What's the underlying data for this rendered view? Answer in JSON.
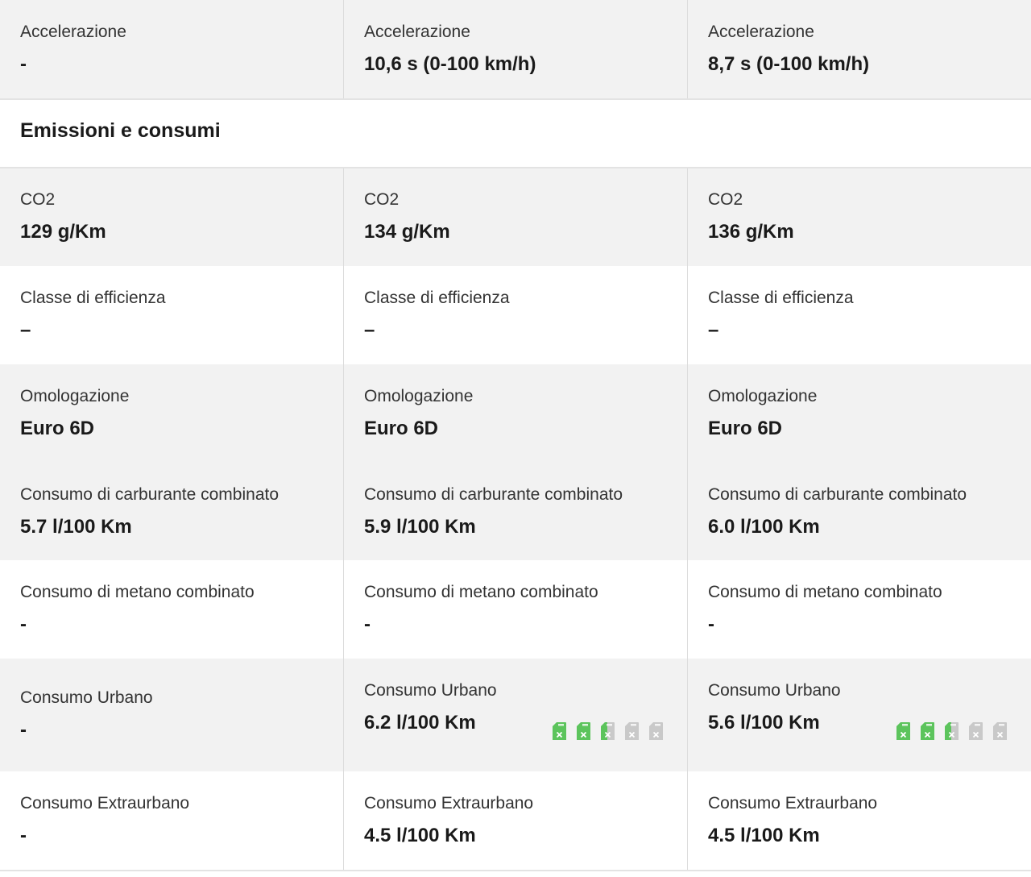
{
  "section_title": "Emissioni e consumi",
  "rows": [
    {
      "label": "Accelerazione",
      "values": [
        "-",
        "10,6 s (0-100 km/h)",
        "8,7 s (0-100 km/h)"
      ]
    },
    {
      "label": "CO2",
      "values": [
        "129 g/Km",
        "134 g/Km",
        "136 g/Km"
      ]
    },
    {
      "label": "Classe di efficienza",
      "values": [
        "–",
        "–",
        "–"
      ]
    },
    {
      "label": "Omologazione",
      "values": [
        "Euro 6D",
        "Euro 6D",
        "Euro 6D"
      ]
    },
    {
      "label": "Consumo di carburante combinato",
      "values": [
        "5.7 l/100 Km",
        "5.9 l/100 Km",
        "6.0 l/100 Km"
      ]
    },
    {
      "label": "Consumo di metano combinato",
      "values": [
        "-",
        "-",
        "-"
      ]
    },
    {
      "label": "Consumo Urbano",
      "values": [
        "-",
        "6.2 l/100 Km",
        "5.6 l/100 Km"
      ]
    },
    {
      "label": "Consumo Extraurbano",
      "values": [
        "-",
        "4.5 l/100 Km",
        "4.5 l/100 Km"
      ]
    }
  ],
  "fuel_rating": {
    "icon": "fuel-can-icon",
    "max": 5,
    "col1_level": 2.5,
    "col2_level": 2.5,
    "colors": {
      "active": "#5cc45c",
      "inactive": "#c9c9c9"
    }
  }
}
